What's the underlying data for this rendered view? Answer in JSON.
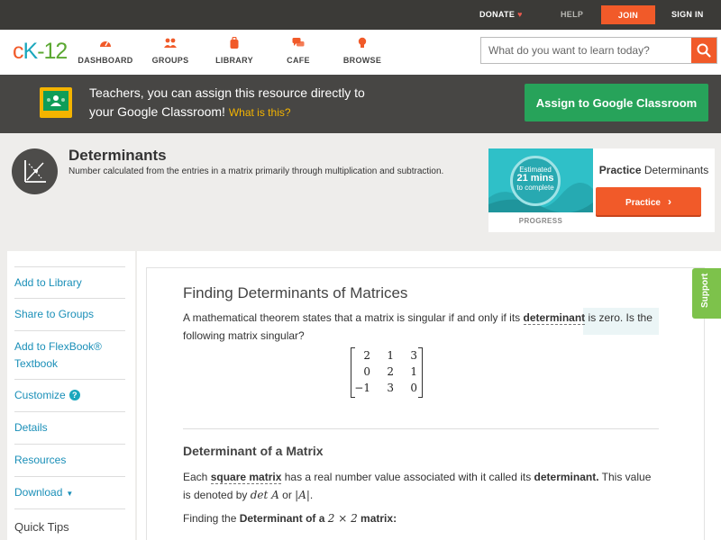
{
  "topbar": {
    "donate": "DONATE",
    "help": "HELP",
    "join": "JOIN",
    "signin": "SIGN IN"
  },
  "nav": {
    "logo": {
      "c": "c",
      "k": "K",
      "num": "-12"
    },
    "items": [
      {
        "label": "DASHBOARD",
        "icon": "gauge-icon"
      },
      {
        "label": "GROUPS",
        "icon": "users-icon"
      },
      {
        "label": "LIBRARY",
        "icon": "backpack-icon"
      },
      {
        "label": "CAFE",
        "icon": "chat-icon"
      },
      {
        "label": "BROWSE",
        "icon": "lightbulb-icon"
      }
    ],
    "search_placeholder": "What do you want to learn today?"
  },
  "banner": {
    "line1": "Teachers, you can assign this resource directly to",
    "line2": "your Google Classroom!",
    "what": "What is this?",
    "assign_label": "Assign to Google Classroom"
  },
  "concept": {
    "title": "Determinants",
    "description": "Number calculated from the entries in a matrix primarily through multiplication and subtraction."
  },
  "practice": {
    "estimated": "Estimated",
    "minutes": "21 mins",
    "to_complete": "to complete",
    "progress_label": "PROGRESS",
    "heading_bold": "Practice",
    "heading_rest": " Determinants",
    "button_label": "Practice"
  },
  "sidebar": {
    "items": [
      {
        "label": "Add to Library"
      },
      {
        "label": "Share to Groups"
      },
      {
        "label": "Add to FlexBook® Textbook"
      },
      {
        "label": "Customize"
      },
      {
        "label": "Details"
      },
      {
        "label": "Resources"
      },
      {
        "label": "Download"
      }
    ],
    "quick_tips": "Quick Tips",
    "help_glyph": "?"
  },
  "content": {
    "title": "Finding Determinants of Matrices",
    "p1_a": "A mathematical theorem states that a matrix is singular if and only if its ",
    "p1_term": "determinant",
    "p1_b": " is zero. Is the following matrix singular?",
    "matrix": [
      [
        "2",
        "1",
        "3"
      ],
      [
        "0",
        "2",
        "1"
      ],
      [
        "−1",
        "3",
        "0"
      ]
    ],
    "sub_title": "Determinant of a Matrix",
    "p2_a": "Each ",
    "p2_term": "square matrix",
    "p2_b": " has a real number value associated with it called its ",
    "p2_bold": "determinant.",
    "p2_c": " This value is denoted by ",
    "p2_math1": "det A",
    "p2_or": " or ",
    "p2_math2": "|A|",
    "p2_end": ".",
    "p3_a": "Finding the ",
    "p3_bold": "Determinant of a",
    "p3_math": "2 × 2",
    "p3_bold2": "matrix:"
  },
  "support": "Support",
  "colors": {
    "orange": "#f15a29",
    "green": "#27a35a",
    "link_blue": "#1a8fb8",
    "dark_bar": "#3b3a37"
  }
}
